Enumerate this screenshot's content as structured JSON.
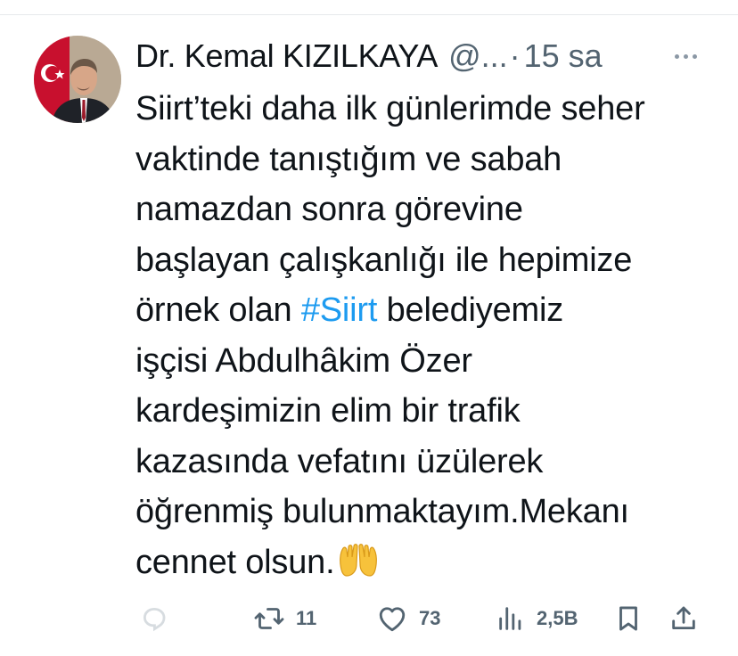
{
  "tweet": {
    "author_name": "Dr. Kemal KIZILKAYA",
    "handle": "@...",
    "separator": "·",
    "time": "15 sa",
    "text_lines": [
      [
        "Siirt’teki daha ilk günlerimde seher"
      ],
      [
        "vaktinde tanıştığım ve sabah"
      ],
      [
        "namazdan sonra görevine"
      ],
      [
        "başlayan çalışkanlığı ile hepimize"
      ],
      [
        "örnek olan ",
        "#Siirt",
        " belediyemiz"
      ],
      [
        "işçisi Abdulhâkim Özer"
      ],
      [
        "kardeşimizin elim bir trafik"
      ],
      [
        "kazasında vefatını üzülerek"
      ],
      [
        "öğrenmiş bulunmaktayım.Mekanı"
      ],
      [
        "cennet olsun."
      ]
    ],
    "hashtag": "#Siirt",
    "emoji": "🤲",
    "hashtag_color": "#1d9bf0"
  },
  "actions": {
    "reply_count": "",
    "retweet_count": "11",
    "like_count": "73",
    "views_count": "2,5B"
  },
  "icons": {
    "avatar": "avatar",
    "more": "more-dots-icon",
    "reply": "reply-icon",
    "retweet": "retweet-icon",
    "like": "heart-icon",
    "views": "views-chart-icon",
    "bookmark": "bookmark-icon",
    "share": "share-icon"
  },
  "colors": {
    "text": "#0f1419",
    "secondary": "#536471",
    "accent": "#1d9bf0"
  }
}
